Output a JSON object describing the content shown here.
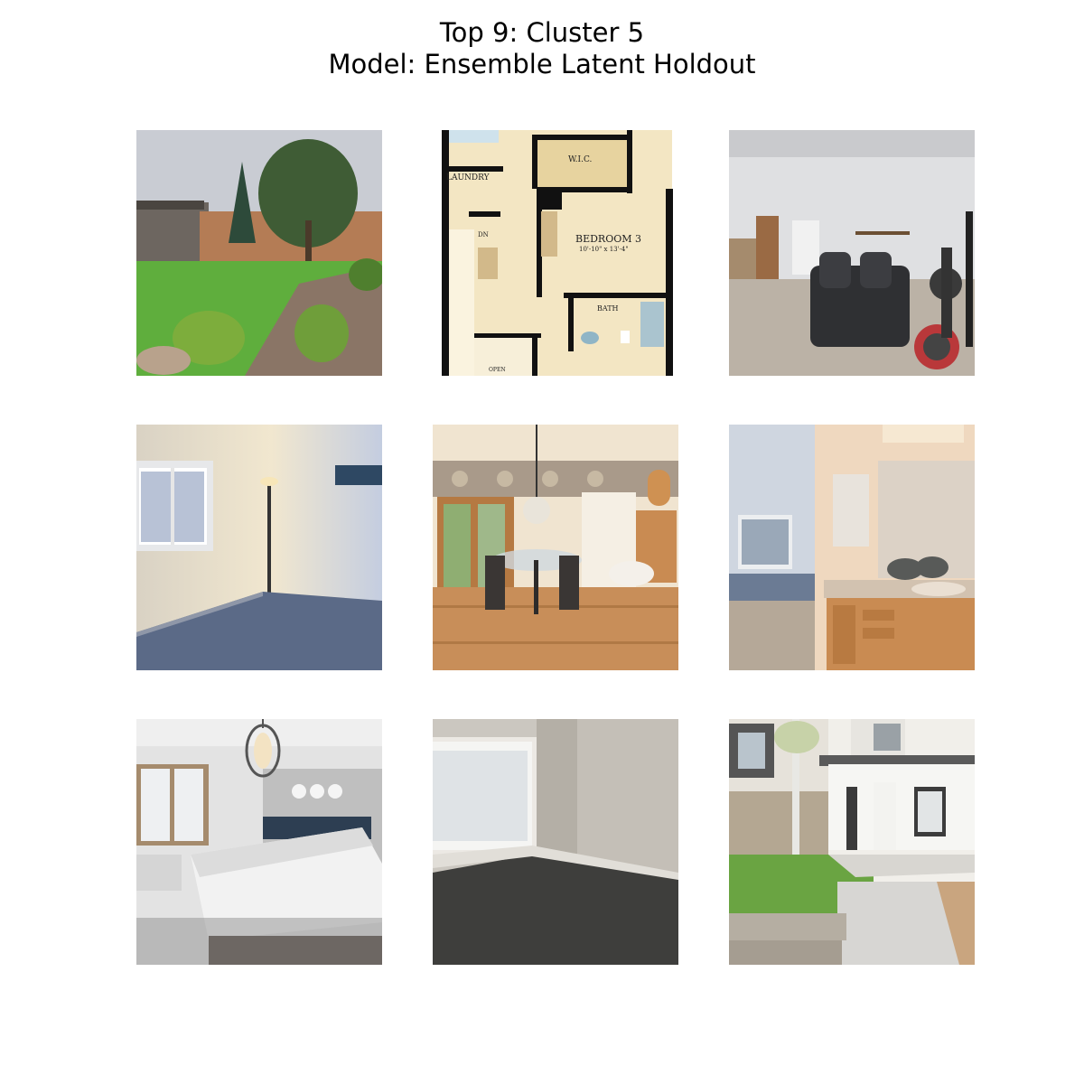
{
  "figure": {
    "title_line1": "Top 9: Cluster 5",
    "title_line2": "Model: Ensemble Latent Holdout"
  },
  "grid": {
    "rows": 3,
    "cols": 3,
    "images": [
      {
        "subject": "backyard with lawn, trees and covered patio"
      },
      {
        "subject": "floor plan",
        "labels": [
          "W.I.C.",
          "LAUNDRY",
          "DN",
          "BEDROOM 3",
          "10'-10\" x 13'-4\"",
          "BATH",
          "OPEN"
        ]
      },
      {
        "subject": "basement living room with recliners and exercise bike"
      },
      {
        "subject": "empty bedroom with window and floor lamp"
      },
      {
        "subject": "dining nook with glass table and chandelier"
      },
      {
        "subject": "bedroom with ensuite bathroom vanity"
      },
      {
        "subject": "bedroom with large bed and pendant light"
      },
      {
        "subject": "empty carpeted room with window"
      },
      {
        "subject": "townhouse back patio with lawn and walkway"
      }
    ]
  }
}
